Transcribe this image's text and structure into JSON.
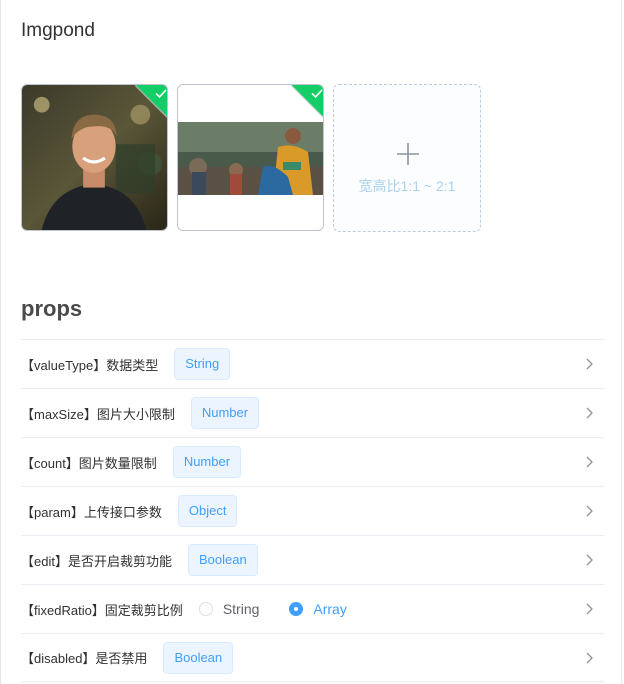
{
  "title": "Imgpond",
  "upload": {
    "add_hint": "宽高比1:1 ~ 2:1"
  },
  "section_title": "props",
  "props": [
    {
      "label": "【valueType】数据类型",
      "tag": "String"
    },
    {
      "label": "【maxSize】图片大小限制",
      "tag": "Number"
    },
    {
      "label": "【count】图片数量限制",
      "tag": "Number"
    },
    {
      "label": "【param】上传接口参数",
      "tag": "Object"
    },
    {
      "label": "【edit】是否开启裁剪功能",
      "tag": "Boolean"
    },
    {
      "label": "【fixedRatio】固定裁剪比例",
      "radio": {
        "options": [
          "String",
          "Array"
        ],
        "selected": "Array"
      }
    },
    {
      "label": "【disabled】是否禁用",
      "tag": "Boolean"
    }
  ],
  "colors": {
    "accent": "#409eff",
    "success": "#13ce66",
    "tag_bg": "#ecf5ff",
    "hint": "#aad1ee"
  },
  "icons": [
    "check-icon",
    "plus-icon",
    "chevron-right-icon"
  ]
}
